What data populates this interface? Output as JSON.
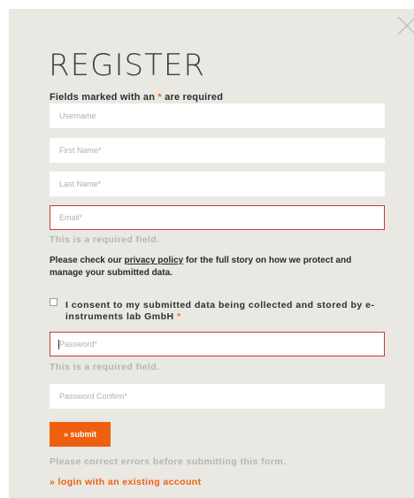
{
  "modal": {
    "title": "REGISTER",
    "required_note": "Fields marked with an",
    "required_star": "*",
    "required_suffix": "are required",
    "close_icon": "close-icon"
  },
  "fields": {
    "username_placeholder": "Username",
    "first_name_placeholder": "First Name*",
    "last_name_placeholder": "Last Name*",
    "email_placeholder": "Email*",
    "email_error": "This is a required field.",
    "password_placeholder": "Password*",
    "password_error": "This is a required field.",
    "password_confirm_placeholder": "Password Confirm*"
  },
  "privacy": {
    "prefix": "Please check our",
    "link": "privacy policy",
    "suffix": "for the full story on how we protect and manage your submitted data."
  },
  "consent": {
    "label": "I consent to my submitted data being collected and stored by e-instruments lab GmbH",
    "star": "*",
    "checked": false
  },
  "actions": {
    "submit_label": "» submit",
    "form_error": "Please correct errors before submitting this form.",
    "login_link": "» login with an existing account"
  },
  "colors": {
    "accent": "#ee6010",
    "error_border": "#c63b3b",
    "panel_bg": "#e9e8e3"
  }
}
